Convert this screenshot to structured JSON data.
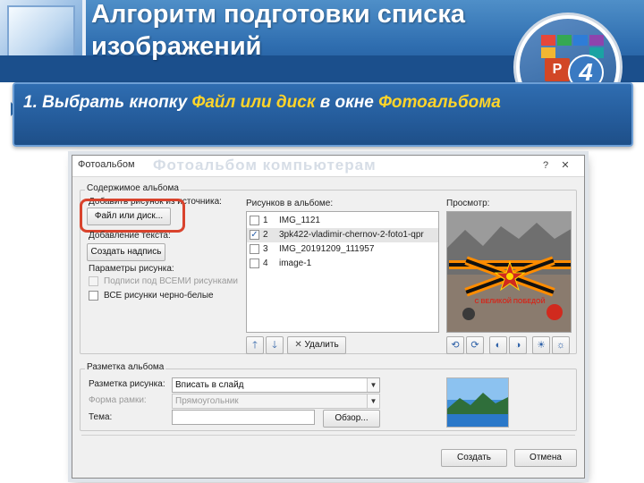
{
  "slide": {
    "title": "Алгоритм подготовки списка изображений",
    "badge_number": "4",
    "badge_app_letter": "P",
    "instruction": {
      "prefix": "1. Выбрать кнопку ",
      "button_name": "Файл или диск",
      "middle": " в окне ",
      "window_name": "Фотоальбома"
    }
  },
  "dialog": {
    "title": "Фотоальбом",
    "ghost_title": "Фотоальбом компьютерам",
    "content_group": {
      "label": "Содержимое альбома",
      "insert_from_label": "Добавить рисунок из источника:",
      "file_disk_button": "Файл или диск...",
      "insert_text_label": "Добавление текста:",
      "new_textbox_button": "Создать надпись",
      "picture_options_label": "Параметры рисунка:",
      "captions_option": "Подписи под ВСЕМИ рисунками",
      "captions_checked": false,
      "bw_option": "ВСЕ рисунки черно-белые",
      "bw_checked": false
    },
    "pictures_in_album": {
      "label": "Рисунков в альбоме:",
      "items": [
        {
          "num": "1",
          "name": "IMG_1121",
          "checked": false
        },
        {
          "num": "2",
          "name": "3pk422-vladimir-chernov-2-foto1-qpr",
          "checked": true
        },
        {
          "num": "3",
          "name": "IMG_20191209_111957",
          "checked": false
        },
        {
          "num": "4",
          "name": "image-1",
          "checked": false
        }
      ],
      "remove_button": "Удалить"
    },
    "preview": {
      "label": "Просмотр:",
      "caption_text": "С ВЕЛИКОЙ ПОБЕДОЙ"
    },
    "album_layout": {
      "label": "Разметка альбома",
      "picture_layout_label": "Разметка рисунка:",
      "picture_layout_value": "Вписать в слайд",
      "frame_shape_label": "Форма рамки:",
      "frame_shape_value": "Прямоугольник",
      "theme_label": "Тема:",
      "theme_value": "",
      "browse_button": "Обзор..."
    },
    "create_button": "Создать",
    "cancel_button": "Отмена"
  },
  "colors": {
    "header_blue": "#2f6eb0",
    "banner_blue": "#245b9a",
    "highlight_yellow": "#ffd42a",
    "highlight_ring": "#d9432d",
    "dialog_bg": "#f0f0f0"
  }
}
